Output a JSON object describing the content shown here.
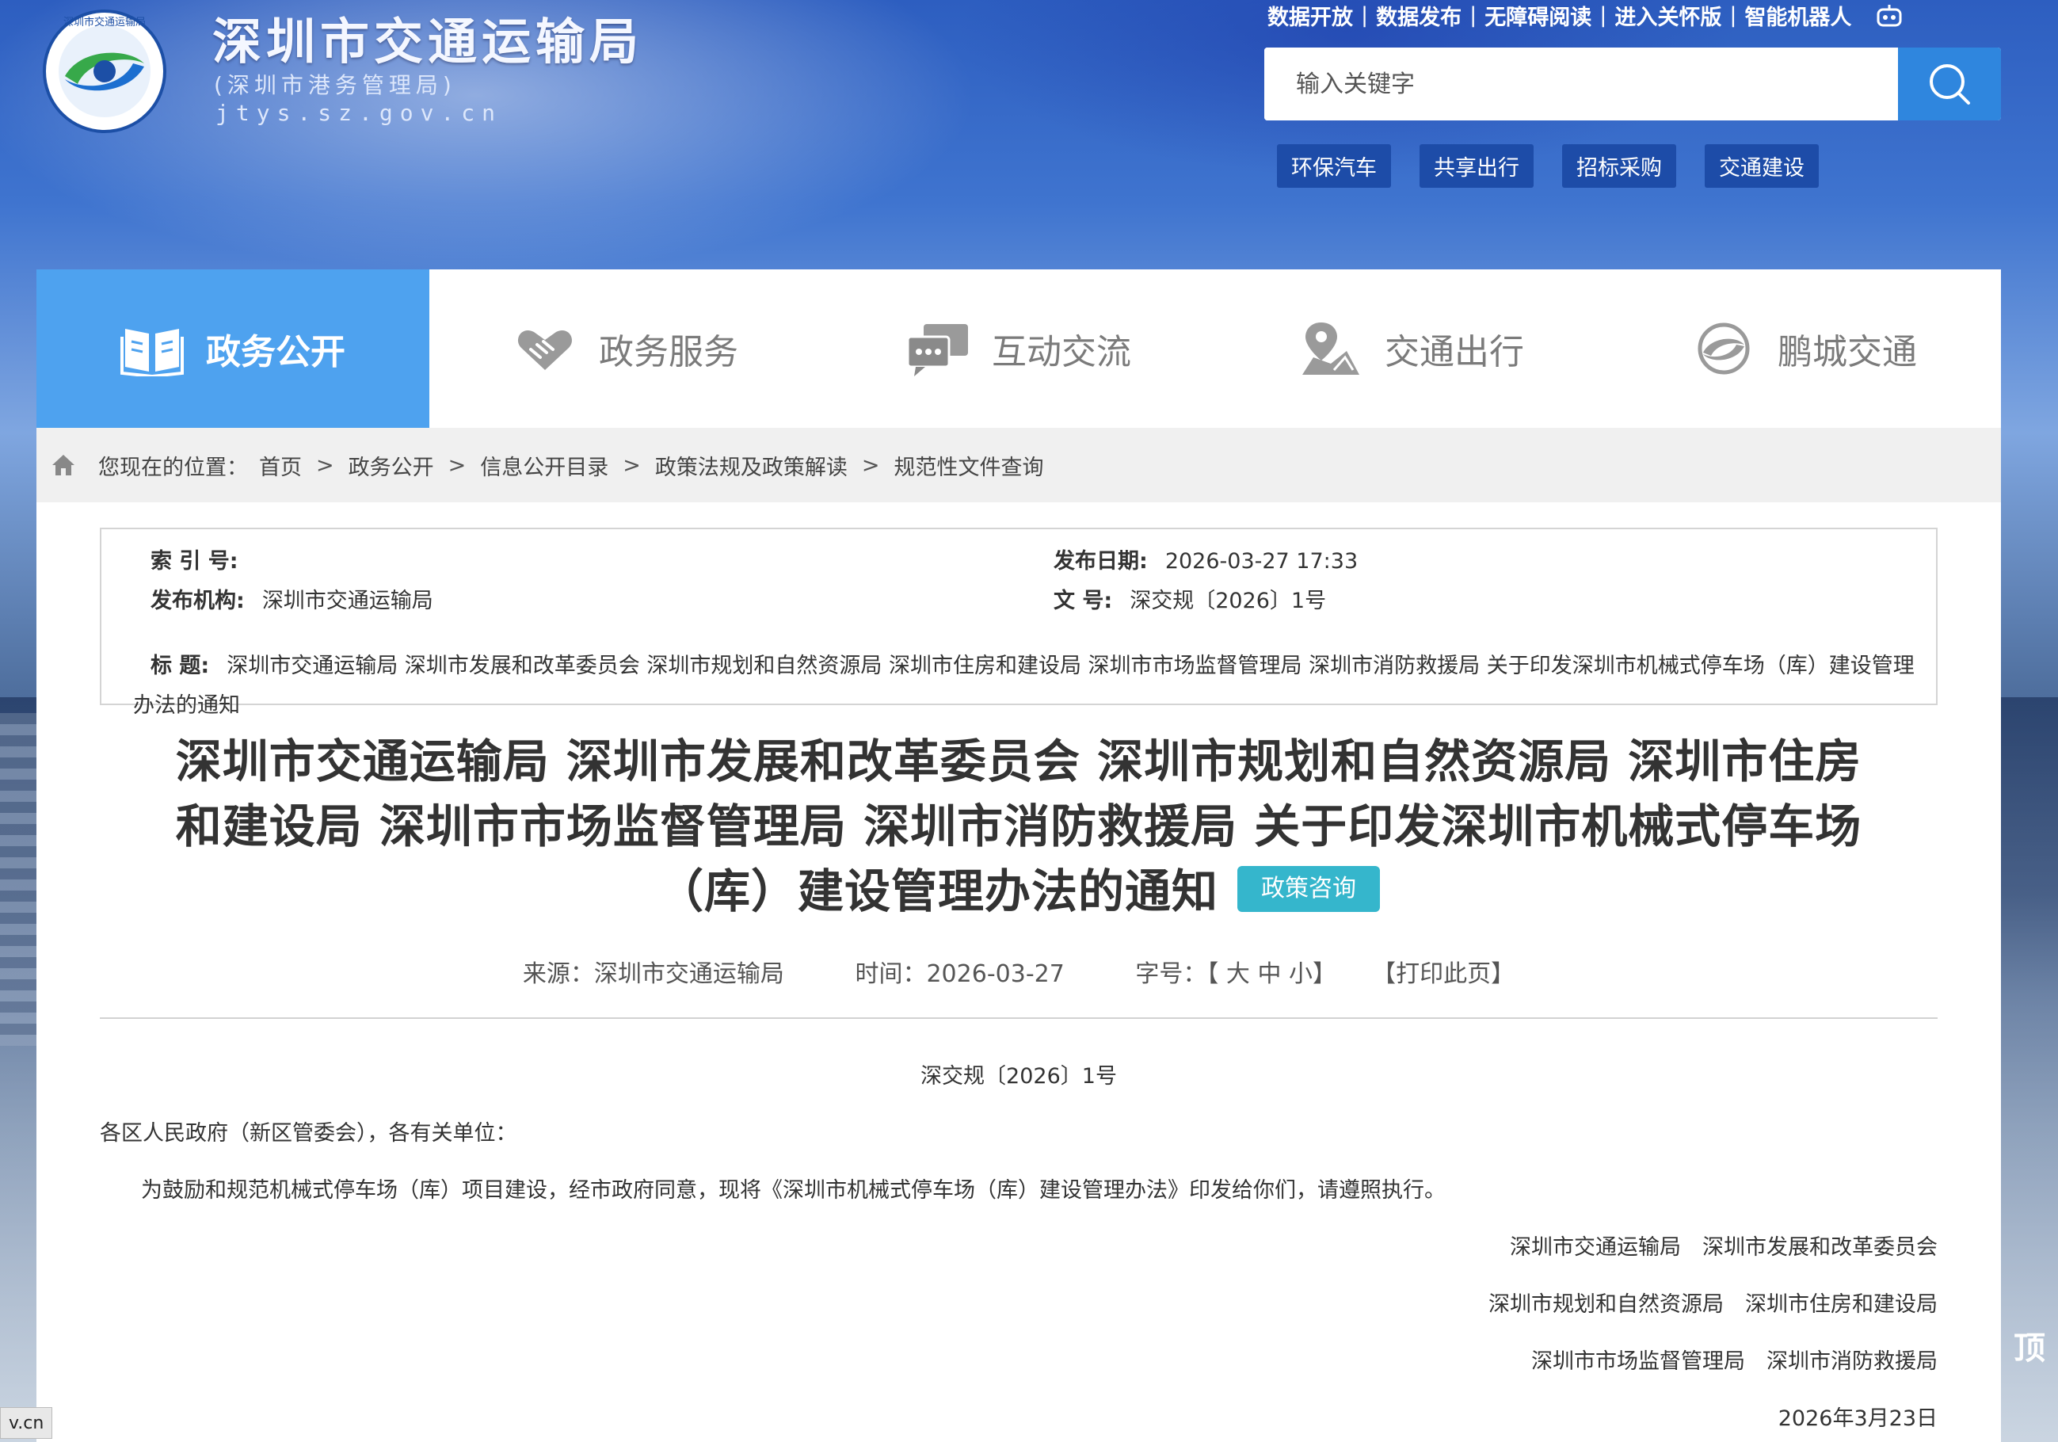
{
  "header": {
    "site_title": "深圳市交通运输局",
    "site_subtitle": "(深圳市港务管理局)",
    "site_domain": "jtys.sz.gov.cn",
    "logo_text": "深圳市交通运输局"
  },
  "toplinks": [
    "数据开放",
    "数据发布",
    "无障碍阅读",
    "进入关怀版",
    "智能机器人"
  ],
  "search": {
    "placeholder": "输入关键字"
  },
  "hot_tags": [
    "环保汽车",
    "共享出行",
    "招标采购",
    "交通建设"
  ],
  "nav": {
    "items": [
      {
        "label": "政务公开",
        "icon": "book-icon",
        "active": true
      },
      {
        "label": "政务服务",
        "icon": "handshake-icon",
        "active": false
      },
      {
        "label": "互动交流",
        "icon": "chat-icon",
        "active": false
      },
      {
        "label": "交通出行",
        "icon": "map-pin-icon",
        "active": false
      },
      {
        "label": "鹏城交通",
        "icon": "swirl-logo-icon",
        "active": false
      }
    ]
  },
  "breadcrumb": {
    "prefix": "您现在的位置：",
    "items": [
      "首页",
      "政务公开",
      "信息公开目录",
      "政策法规及政策解读",
      "规范性文件查询"
    ],
    "separator": ">"
  },
  "meta": {
    "index_key": "索 引 号:",
    "index_value": "",
    "date_key": "发布日期:",
    "date_value": "2026-03-27 17:33",
    "org_key": "发布机构:",
    "org_value": "深圳市交通运输局",
    "docno_key": "文 号:",
    "docno_value": "深交规〔2026〕1号",
    "title_key": "标 题:",
    "title_value": "深圳市交通运输局 深圳市发展和改革委员会 深圳市规划和自然资源局 深圳市住房和建设局 深圳市市场监督管理局 深圳市消防救援局 关于印发深圳市机械式停车场（库）建设管理办法的通知"
  },
  "article": {
    "title": "深圳市交通运输局 深圳市发展和改革委员会 深圳市规划和自然资源局 深圳市住房和建设局 深圳市市场监督管理局 深圳市消防救援局 关于印发深圳市机械式停车场（库）建设管理办法的通知",
    "tag": "政策咨询",
    "source": "来源：深圳市交通运输局",
    "time": "时间：2026-03-27",
    "font_size_label": "字号：【 大 中 小】",
    "print_label": "【打印此页】",
    "doc_no": "深交规〔2026〕1号",
    "addressee": "各区人民政府（新区管委会），各有关单位：",
    "body": "为鼓励和规范机械式停车场（库）项目建设，经市政府同意，现将《深圳市机械式停车场（库）建设管理办法》印发给你们，请遵照执行。",
    "signers": [
      "深圳市交通运输局　深圳市发展和改革委员会",
      "深圳市规划和自然资源局　深圳市住房和建设局",
      "深圳市市场监督管理局　深圳市消防救援局"
    ],
    "date": "2026年3月23日"
  },
  "status_bar": {
    "url_fragment": "v.cn"
  },
  "side_widget": {
    "label": "顶"
  },
  "colors": {
    "nav_active": "#4ea2ef",
    "search_button": "#2f86de",
    "tag_bg": "#35b6cc",
    "hot_tag_bg": "#1d4ca8"
  }
}
